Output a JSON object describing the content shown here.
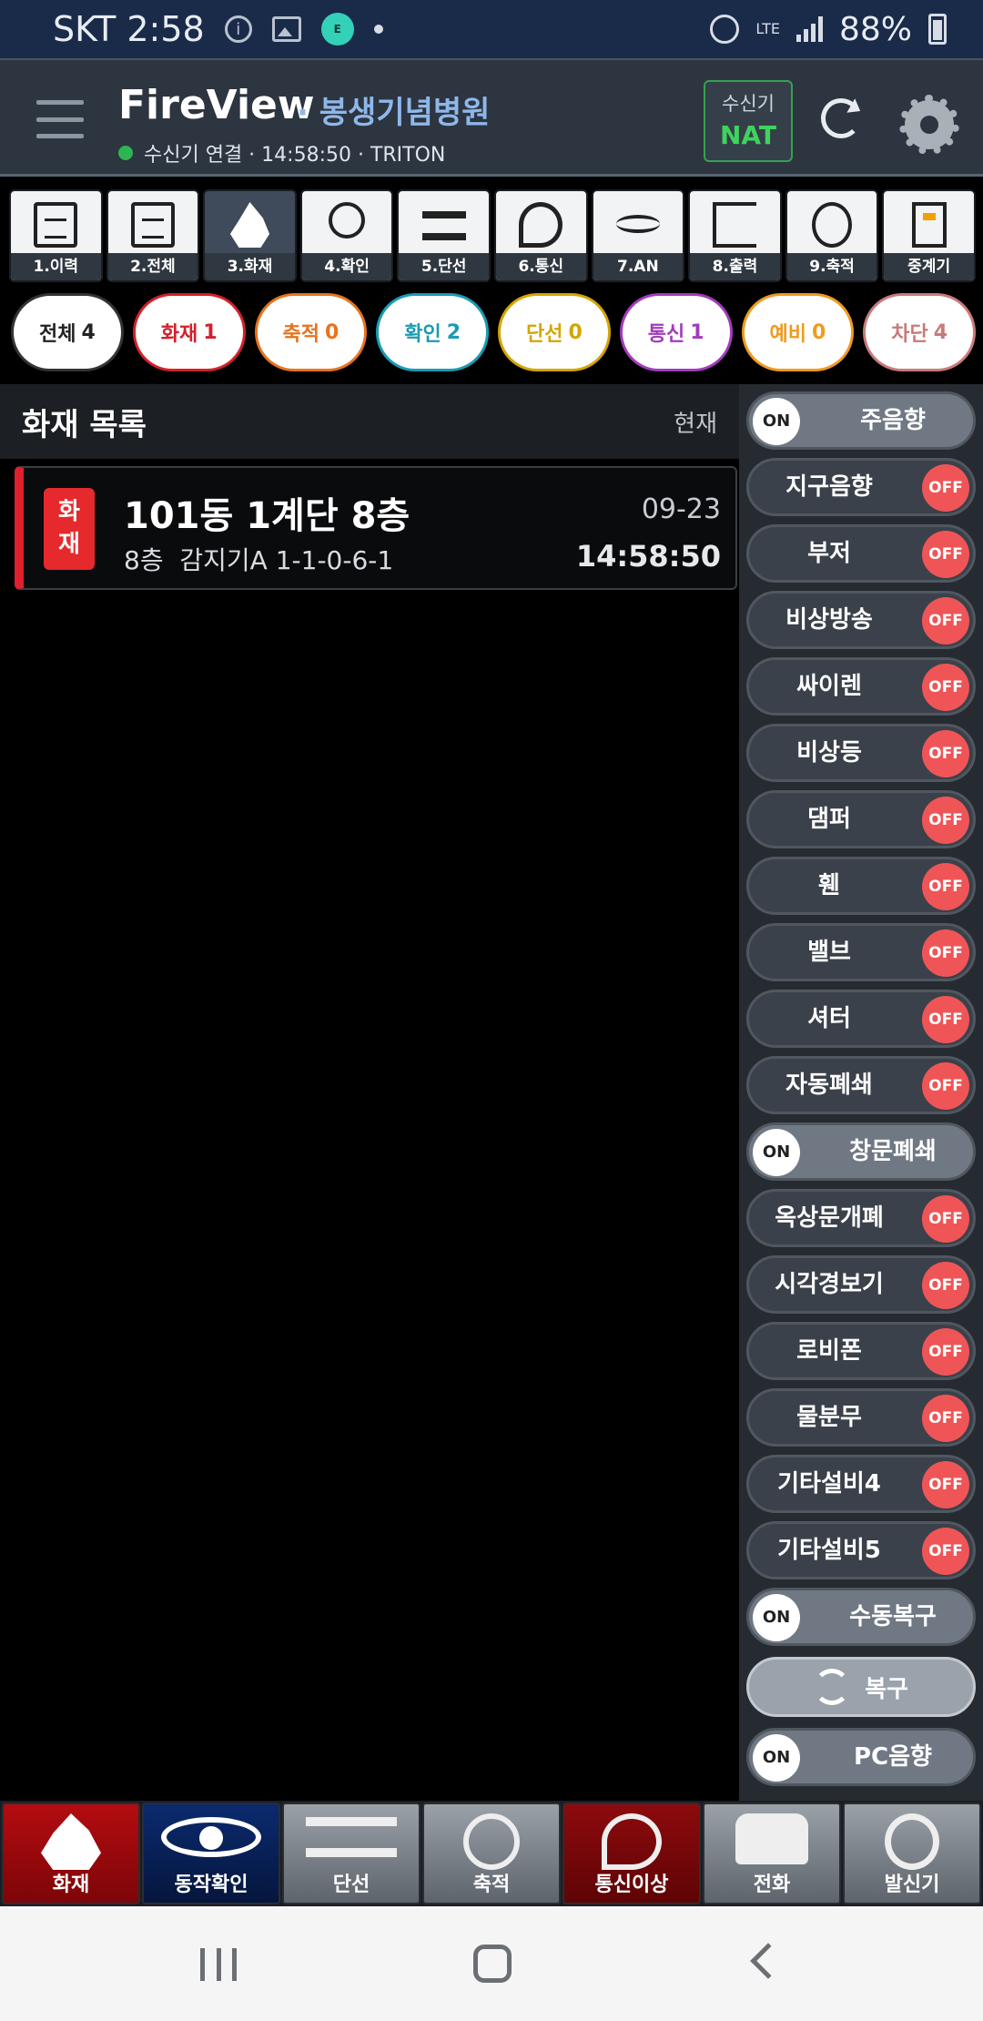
{
  "status_bar": {
    "carrier_time": "SKT 2:58",
    "network": "LTE",
    "battery": "88%"
  },
  "header": {
    "app_name": "FireView",
    "site_name": "· 봉생기념병원",
    "connection": "수신기 연결 · 14:58:50 · TRITON",
    "receiver_label": "수신기",
    "receiver_mode": "NAT",
    "connection_status_color": "#2db552"
  },
  "tabs": [
    {
      "label": "1.이력",
      "icon": "history-doc-icon"
    },
    {
      "label": "2.전체",
      "icon": "all-docs-icon"
    },
    {
      "label": "3.화재",
      "icon": "fire-icon",
      "active": true
    },
    {
      "label": "4.확인",
      "icon": "search-check-icon"
    },
    {
      "label": "5.단선",
      "icon": "broken-line-icon"
    },
    {
      "label": "6.통신",
      "icon": "satellite-dish-icon"
    },
    {
      "label": "7.AN",
      "icon": "wave-icon"
    },
    {
      "label": "8.출력",
      "icon": "exit-icon"
    },
    {
      "label": "9.축적",
      "icon": "clock-icon"
    },
    {
      "label": "중계기",
      "icon": "relay-icon"
    }
  ],
  "filters": [
    {
      "name": "전체",
      "count": "4",
      "color": "#222222"
    },
    {
      "name": "화재",
      "count": "1",
      "color": "#d3202a"
    },
    {
      "name": "축적",
      "count": "0",
      "color": "#e8731c"
    },
    {
      "name": "확인",
      "count": "2",
      "color": "#1a9bb5"
    },
    {
      "name": "단선",
      "count": "0",
      "color": "#d4a500"
    },
    {
      "name": "통신",
      "count": "1",
      "color": "#a23bbd"
    },
    {
      "name": "예비",
      "count": "0",
      "color": "#f09a1e"
    },
    {
      "name": "차단",
      "count": "4",
      "color": "#c97a7a"
    }
  ],
  "list": {
    "title": "화재 목록",
    "now_label": "현재",
    "events": [
      {
        "badge": "화\n재",
        "title": "101동 1계단 8층",
        "detail": "8층  감지기A 1-1-0-6-1",
        "date": "09-23",
        "time": "14:58:50"
      }
    ]
  },
  "controls": [
    {
      "label": "주음향",
      "state": "ON"
    },
    {
      "label": "지구음향",
      "state": "OFF"
    },
    {
      "label": "부저",
      "state": "OFF"
    },
    {
      "label": "비상방송",
      "state": "OFF"
    },
    {
      "label": "싸이렌",
      "state": "OFF"
    },
    {
      "label": "비상등",
      "state": "OFF"
    },
    {
      "label": "댐퍼",
      "state": "OFF"
    },
    {
      "label": "휀",
      "state": "OFF"
    },
    {
      "label": "밸브",
      "state": "OFF"
    },
    {
      "label": "셔터",
      "state": "OFF"
    },
    {
      "label": "자동폐쇄",
      "state": "OFF"
    },
    {
      "label": "창문폐쇄",
      "state": "ON"
    },
    {
      "label": "옥상문개폐",
      "state": "OFF"
    },
    {
      "label": "시각경보기",
      "state": "OFF"
    },
    {
      "label": "로비폰",
      "state": "OFF"
    },
    {
      "label": "물분무",
      "state": "OFF"
    },
    {
      "label": "기타설비4",
      "state": "OFF"
    },
    {
      "label": "기타설비5",
      "state": "OFF"
    },
    {
      "label": "수동복구",
      "state": "ON"
    }
  ],
  "reset_button": "복구",
  "pc_sound": {
    "label": "PC음향",
    "state": "ON"
  },
  "function_bar": [
    {
      "label": "화재",
      "icon": "fire-icon",
      "style": "red"
    },
    {
      "label": "동작확인",
      "icon": "eye-icon",
      "style": "blue"
    },
    {
      "label": "단선",
      "icon": "broken-line-icon",
      "style": "gray"
    },
    {
      "label": "축적",
      "icon": "clock-icon",
      "style": "gray"
    },
    {
      "label": "통신이상",
      "icon": "satellite-dish-icon",
      "style": "dark-red"
    },
    {
      "label": "전화",
      "icon": "phone-icon",
      "style": "gray"
    },
    {
      "label": "발신기",
      "icon": "bell-icon",
      "style": "gray"
    }
  ]
}
